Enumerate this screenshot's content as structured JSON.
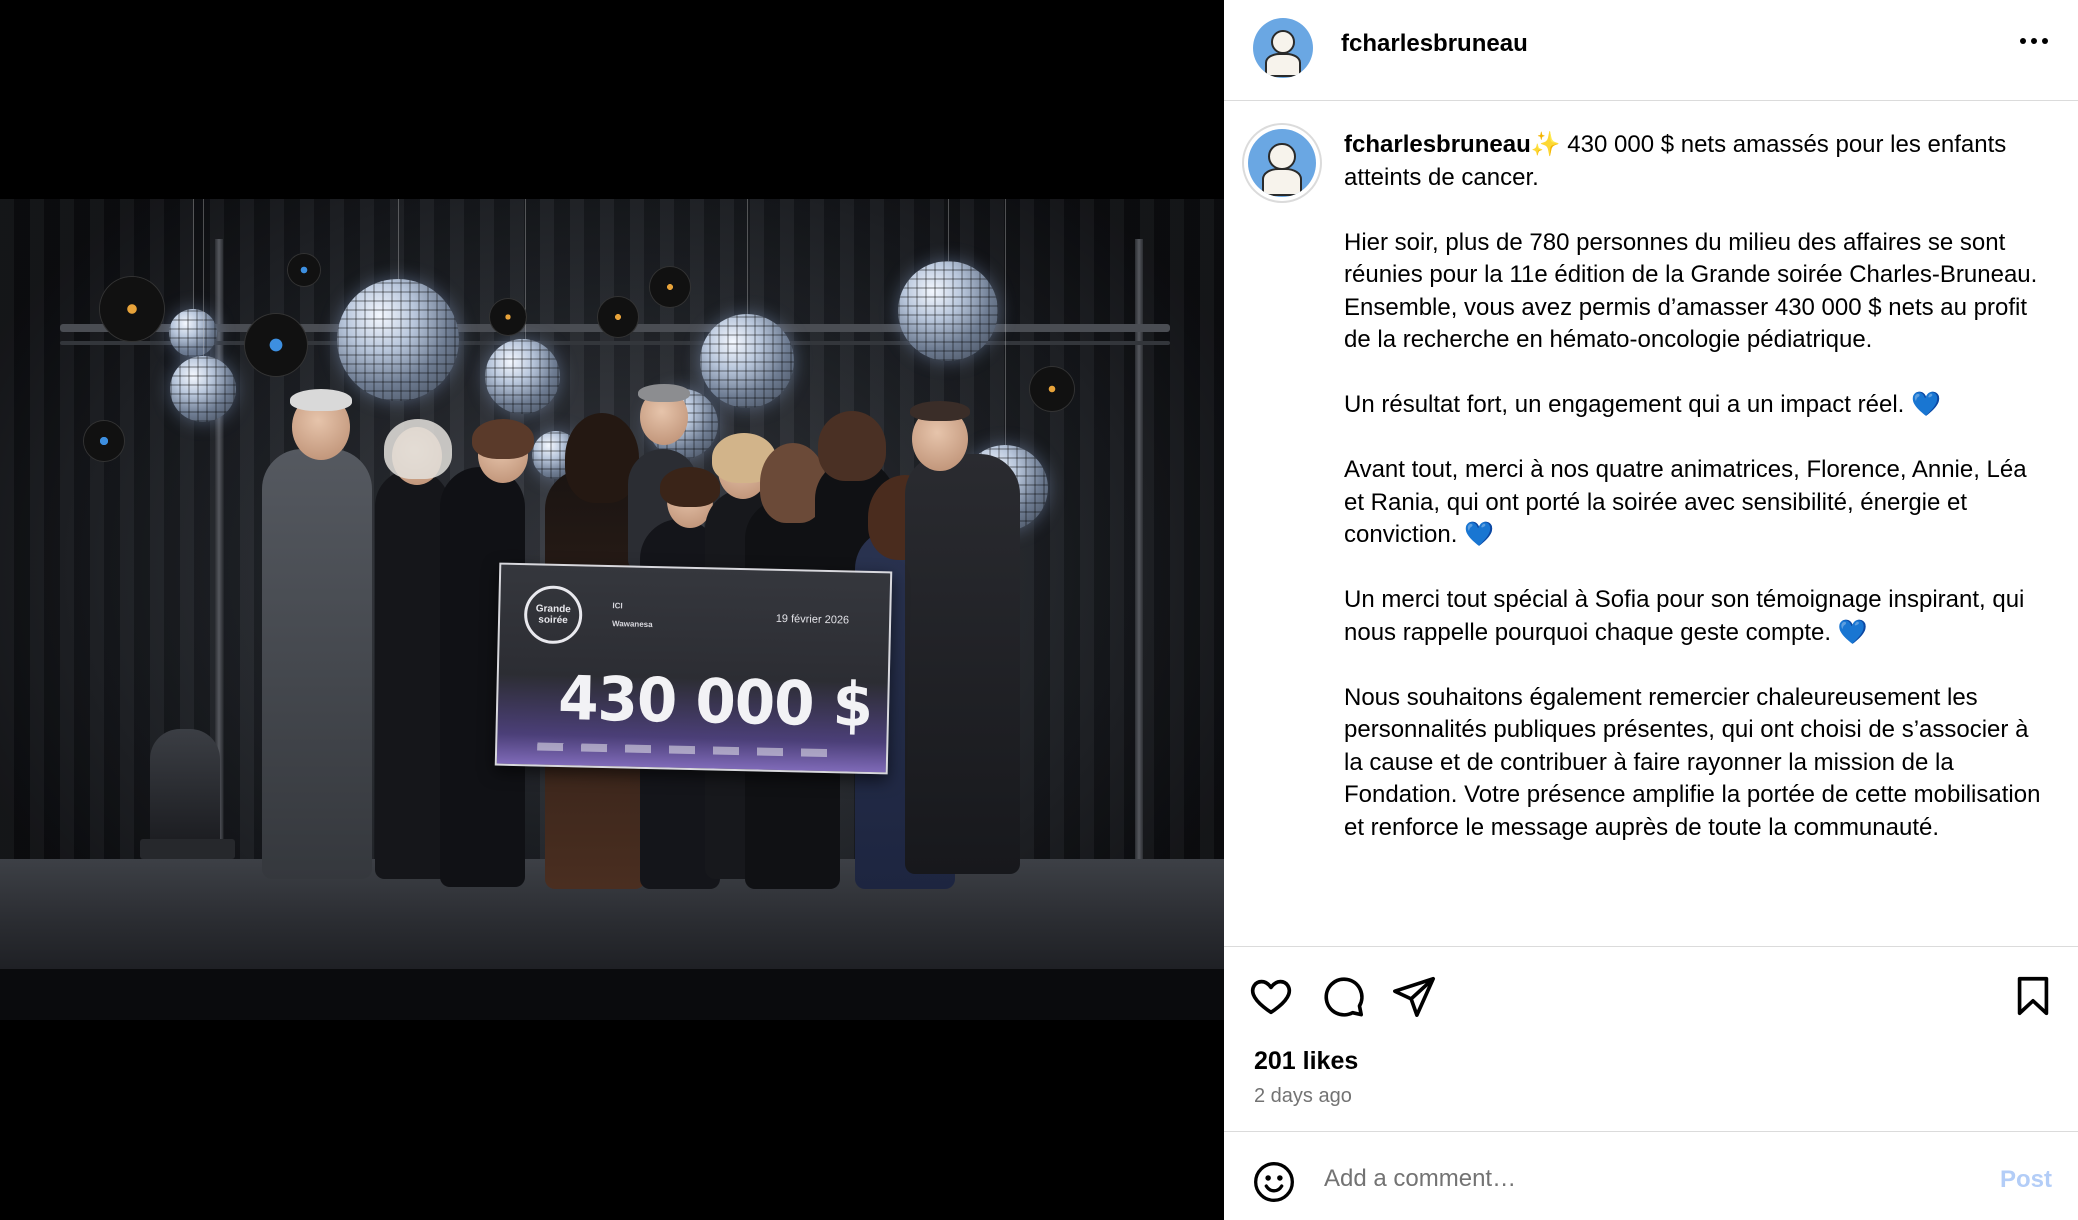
{
  "post": {
    "username": "fcharlesbruneau",
    "more_icon": "more-horizontal-icon"
  },
  "photo": {
    "cheque": {
      "logo_text": "Grande soirée",
      "sponsor_line_1": "ICI",
      "sponsor_line_2": "Wawanesa",
      "date": "19 février 2026",
      "amount": "430 000 $"
    }
  },
  "caption": {
    "username": "fcharlesbruneau",
    "sparkle": "✨",
    "paragraphs": [
      " 430 000 $ nets amassés pour les enfants atteints de cancer.",
      "Hier soir, plus de 780 personnes du milieu des affaires se sont réunies pour la 11e édition de la Grande soirée Charles-Bruneau. Ensemble, vous avez permis d’amasser 430 000 $ nets au profit de la recherche en hémato-oncologie pédiatrique.",
      "Un résultat fort, un engagement qui a un impact réel. 💙",
      "Avant tout, merci à nos quatre animatrices, Florence, Annie, Léa et Rania, qui ont porté la soirée avec sensibilité, énergie et conviction. 💙",
      "Un merci tout spécial à Sofia pour son témoignage inspirant, qui nous rappelle pourquoi chaque geste compte. 💙",
      "Nous souhaitons également remercier chaleureusement les personnalités publiques présentes, qui ont choisi de s’associer à la cause et de contribuer à faire rayonner la mission de la Fondation. Votre présence amplifie la portée de cette mobilisation et renforce le message auprès de toute la communauté."
    ]
  },
  "actions": {
    "like_icon": "heart-icon",
    "comment_icon": "comment-icon",
    "share_icon": "send-icon",
    "save_icon": "bookmark-icon",
    "likes": "201 likes",
    "timestamp": "2 days ago"
  },
  "comment": {
    "placeholder": "Add a comment…",
    "post_label": "Post",
    "emoji_icon": "smiley-icon"
  },
  "colors": {
    "post_button": "#b3cdf7",
    "muted_text": "#737373",
    "divider": "#dbdbdb",
    "avatar_bg": "#6aa7e3",
    "heart_emoji": "#3d7be0"
  }
}
